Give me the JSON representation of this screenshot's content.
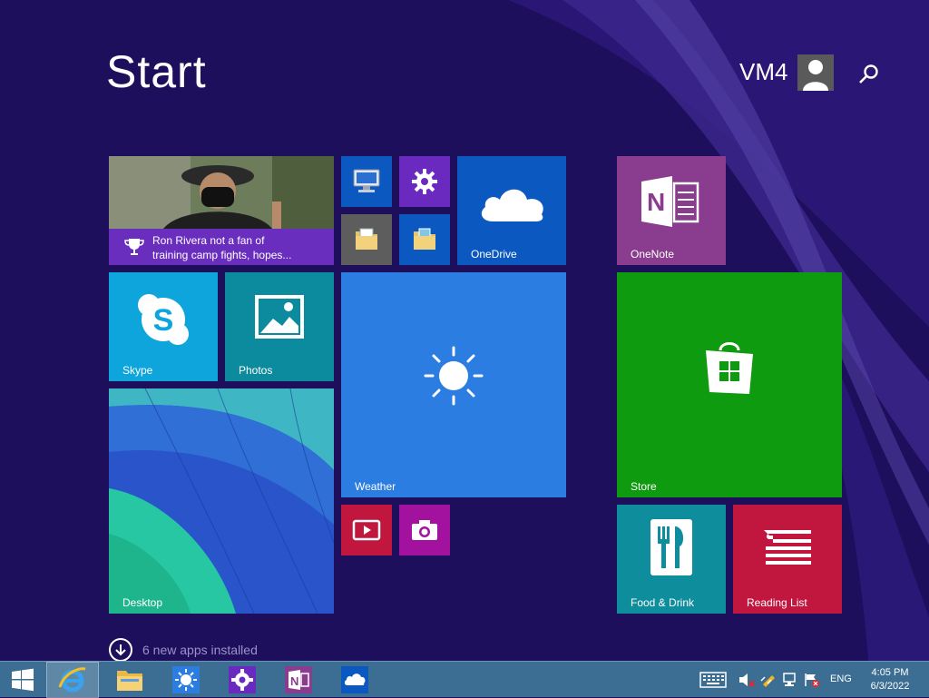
{
  "header": {
    "title": "Start",
    "user_name": "VM4",
    "search_icon": "search-icon"
  },
  "tiles": {
    "news": {
      "headline_line1": "Ron Rivera not a fan of",
      "headline_line2": "training camp fights, hopes...",
      "icon": "trophy-icon"
    },
    "this_pc": {
      "icon": "computer-icon"
    },
    "pc_settings": {
      "icon": "gear-icon"
    },
    "onedrive": {
      "label": "OneDrive",
      "icon": "cloud-icon"
    },
    "onenote": {
      "label": "OneNote",
      "icon": "onenote-icon"
    },
    "documents": {
      "icon": "folder-icon"
    },
    "pictures": {
      "icon": "folder-icon"
    },
    "skype": {
      "label": "Skype",
      "icon": "skype-icon"
    },
    "photos": {
      "label": "Photos",
      "icon": "photos-icon"
    },
    "weather": {
      "label": "Weather",
      "icon": "sun-icon"
    },
    "store": {
      "label": "Store",
      "icon": "shopping-bag-icon"
    },
    "desktop": {
      "label": "Desktop"
    },
    "video": {
      "icon": "video-icon"
    },
    "camera": {
      "icon": "camera-icon"
    },
    "food_drink": {
      "label": "Food & Drink",
      "icon": "fork-knife-icon"
    },
    "reading_list": {
      "label": "Reading List",
      "icon": "reading-list-icon"
    }
  },
  "apps_installed": {
    "text": "6 new apps installed",
    "icon": "arrow-down-circle-icon"
  },
  "colors": {
    "background": "#1e0f5c",
    "onedrive": "#0b58c0",
    "onenote": "#8a3c8e",
    "skype": "#0ea5dc",
    "photos": "#0c8a9e",
    "weather": "#2b7de1",
    "store": "#0f9b0f",
    "food_drink": "#0e8e9d",
    "reading_list": "#c1163d",
    "settings": "#6a2abf",
    "taskbar": "#3b6e92"
  },
  "taskbar": {
    "apps": [
      "windows-logo-icon",
      "internet-explorer-icon",
      "file-explorer-icon",
      "weather-icon",
      "settings-icon",
      "onenote-icon",
      "onedrive-icon"
    ],
    "language": "ENG",
    "time": "4:05 PM",
    "date": "6/3/2022"
  }
}
